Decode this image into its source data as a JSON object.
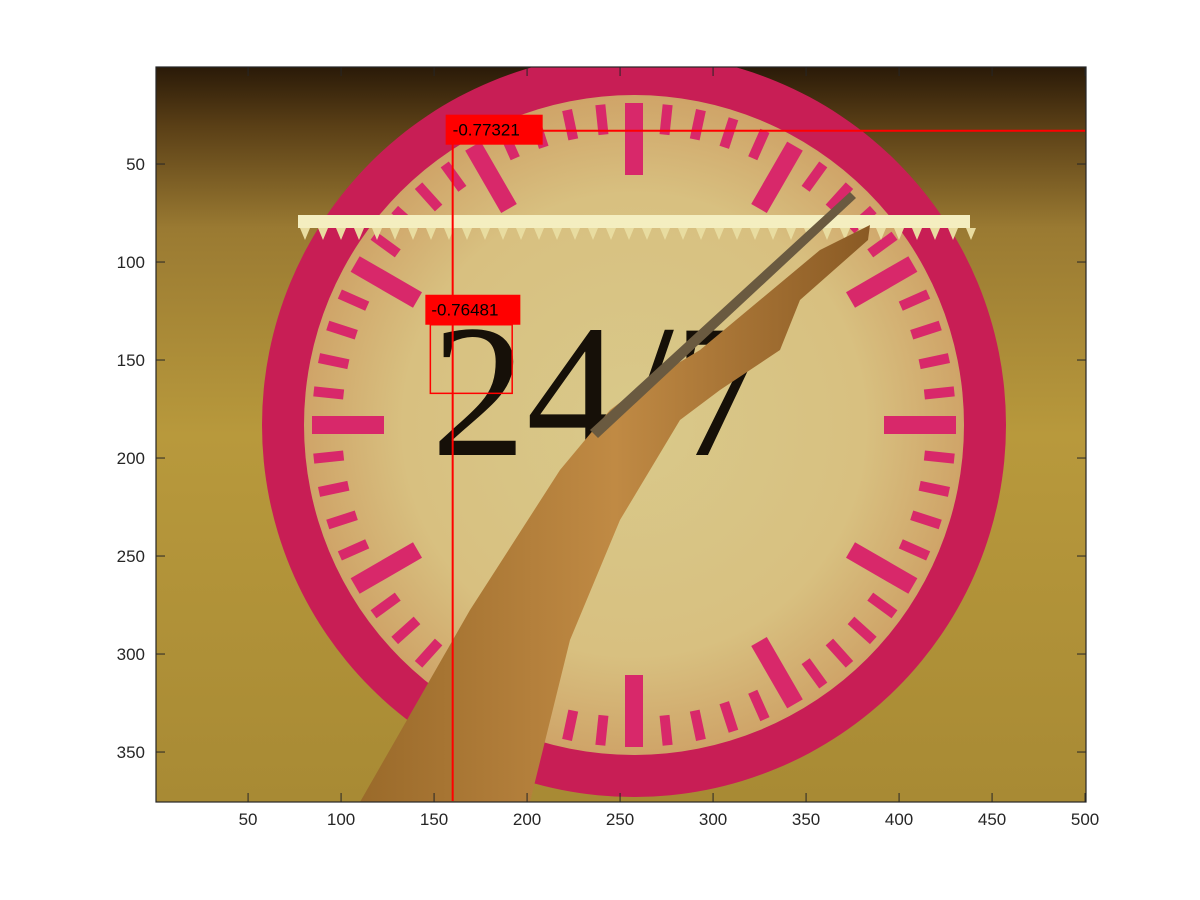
{
  "axes": {
    "x_ticks": [
      50,
      100,
      150,
      200,
      250,
      300,
      350,
      400,
      450,
      500
    ],
    "y_ticks": [
      50,
      100,
      150,
      200,
      250,
      300,
      350
    ],
    "x_range": [
      0.5,
      500.5
    ],
    "y_range": [
      0.5,
      375.5
    ],
    "y_direction": "reversed",
    "axis_color": "#262626"
  },
  "clock": {
    "face_text": "24/7",
    "ring_color": "#d2235c",
    "wall_color": "#b8993c"
  },
  "annotations": {
    "color": "#ff0000",
    "line": {
      "label": "-0.77321",
      "x_start": 160,
      "x_end": 500,
      "y_start": 33,
      "y_end": 375
    },
    "box": {
      "label": "-0.76481",
      "x_min": 148,
      "x_max": 192,
      "y_min": 132,
      "y_max": 167
    }
  }
}
